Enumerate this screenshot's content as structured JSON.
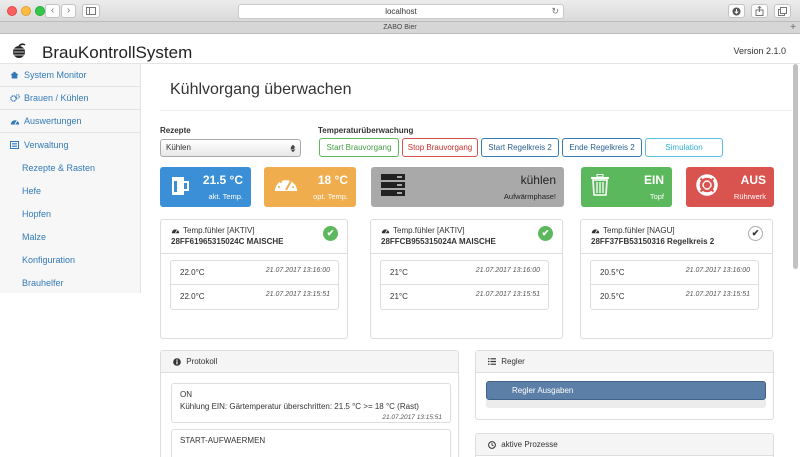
{
  "browser": {
    "url": "localhost",
    "tab_title": "ZABO Bier",
    "back_glyph": "‹",
    "forward_glyph": "›",
    "reload_glyph": "↻",
    "new_tab_glyph": "+"
  },
  "header": {
    "brand": "BrauKontrollSystem",
    "version": "Version 2.1.0"
  },
  "sidebar": {
    "items": [
      {
        "label": "System Monitor",
        "icon": "home-icon"
      },
      {
        "label": "Brauen / Kühlen",
        "icon": "cogs-icon"
      },
      {
        "label": "Auswertungen",
        "icon": "gauge-icon"
      },
      {
        "label": "Verwaltung",
        "icon": "list-icon"
      }
    ],
    "subitems": [
      "Rezepte & Rasten",
      "Hefe",
      "Hopfen",
      "Malze",
      "Konfiguration",
      "Brauhelfer"
    ]
  },
  "main": {
    "title": "Kühlvorgang überwachen",
    "recipe_label": "Rezepte",
    "recipe_value": "Kühlen",
    "monitor_label": "Temperaturüberwachung",
    "buttons": {
      "start": "Start Brauvorgang",
      "stop": "Stop Brauvorgang",
      "start_rk": "Start Regelkreis 2",
      "end_rk": "Ende Regelkreis 2",
      "sim": "Simulation"
    }
  },
  "tiles": {
    "akt": {
      "value": "21.5 °C",
      "label": "akt. Temp."
    },
    "opt": {
      "value": "18 °C",
      "label": "opt. Temp."
    },
    "phase": {
      "value": "kühlen",
      "label": "Aufwärmphase!"
    },
    "topf": {
      "value": "EIN",
      "label": "Topf"
    },
    "ruehr": {
      "value": "AUS",
      "label": "Rührwerk"
    }
  },
  "sensors": [
    {
      "head": "Temp.fühler [AKTIV]",
      "id": "28FF61965315024C MAISCHE",
      "status": "active",
      "readings": [
        {
          "v": "22.0°C",
          "t": "21.07.2017 13:16:00"
        },
        {
          "v": "22.0°C",
          "t": "21.07.2017 13:15:51"
        }
      ]
    },
    {
      "head": "Temp.fühler [AKTIV]",
      "id": "28FFCB955315024A MAISCHE",
      "status": "active",
      "readings": [
        {
          "v": "21°C",
          "t": "21.07.2017 13:16:00"
        },
        {
          "v": "21°C",
          "t": "21.07.2017 13:15:51"
        }
      ]
    },
    {
      "head": "Temp.fühler [NAGU]",
      "id": "28FF37FB53150316 Regelkreis 2",
      "status": "idle",
      "readings": [
        {
          "v": "20.5°C",
          "t": "21.07.2017 13:16:00"
        },
        {
          "v": "20.5°C",
          "t": "21.07.2017 13:15:51"
        }
      ]
    }
  ],
  "protokoll": {
    "title": "Protokoll",
    "entries": [
      {
        "l1": "ON",
        "l2": "Kühlung EIN: Gärtemperatur überschritten: 21.5 °C >= 18 °C (Rast)",
        "t": "21.07.2017 13:15:51"
      },
      {
        "l1": "START-AUFWAERMEN"
      }
    ]
  },
  "regler": {
    "title": "Regler",
    "button": "Regler Ausgaben"
  },
  "prozesse": {
    "title": "aktive Prozesse"
  },
  "check_glyph": "✔",
  "colors": {
    "blue": "#3a8fd6",
    "orange": "#f0ad4e",
    "gray": "#a9a9a9",
    "green": "#5cb85c",
    "red": "#d9534f",
    "link": "#337ab7"
  }
}
